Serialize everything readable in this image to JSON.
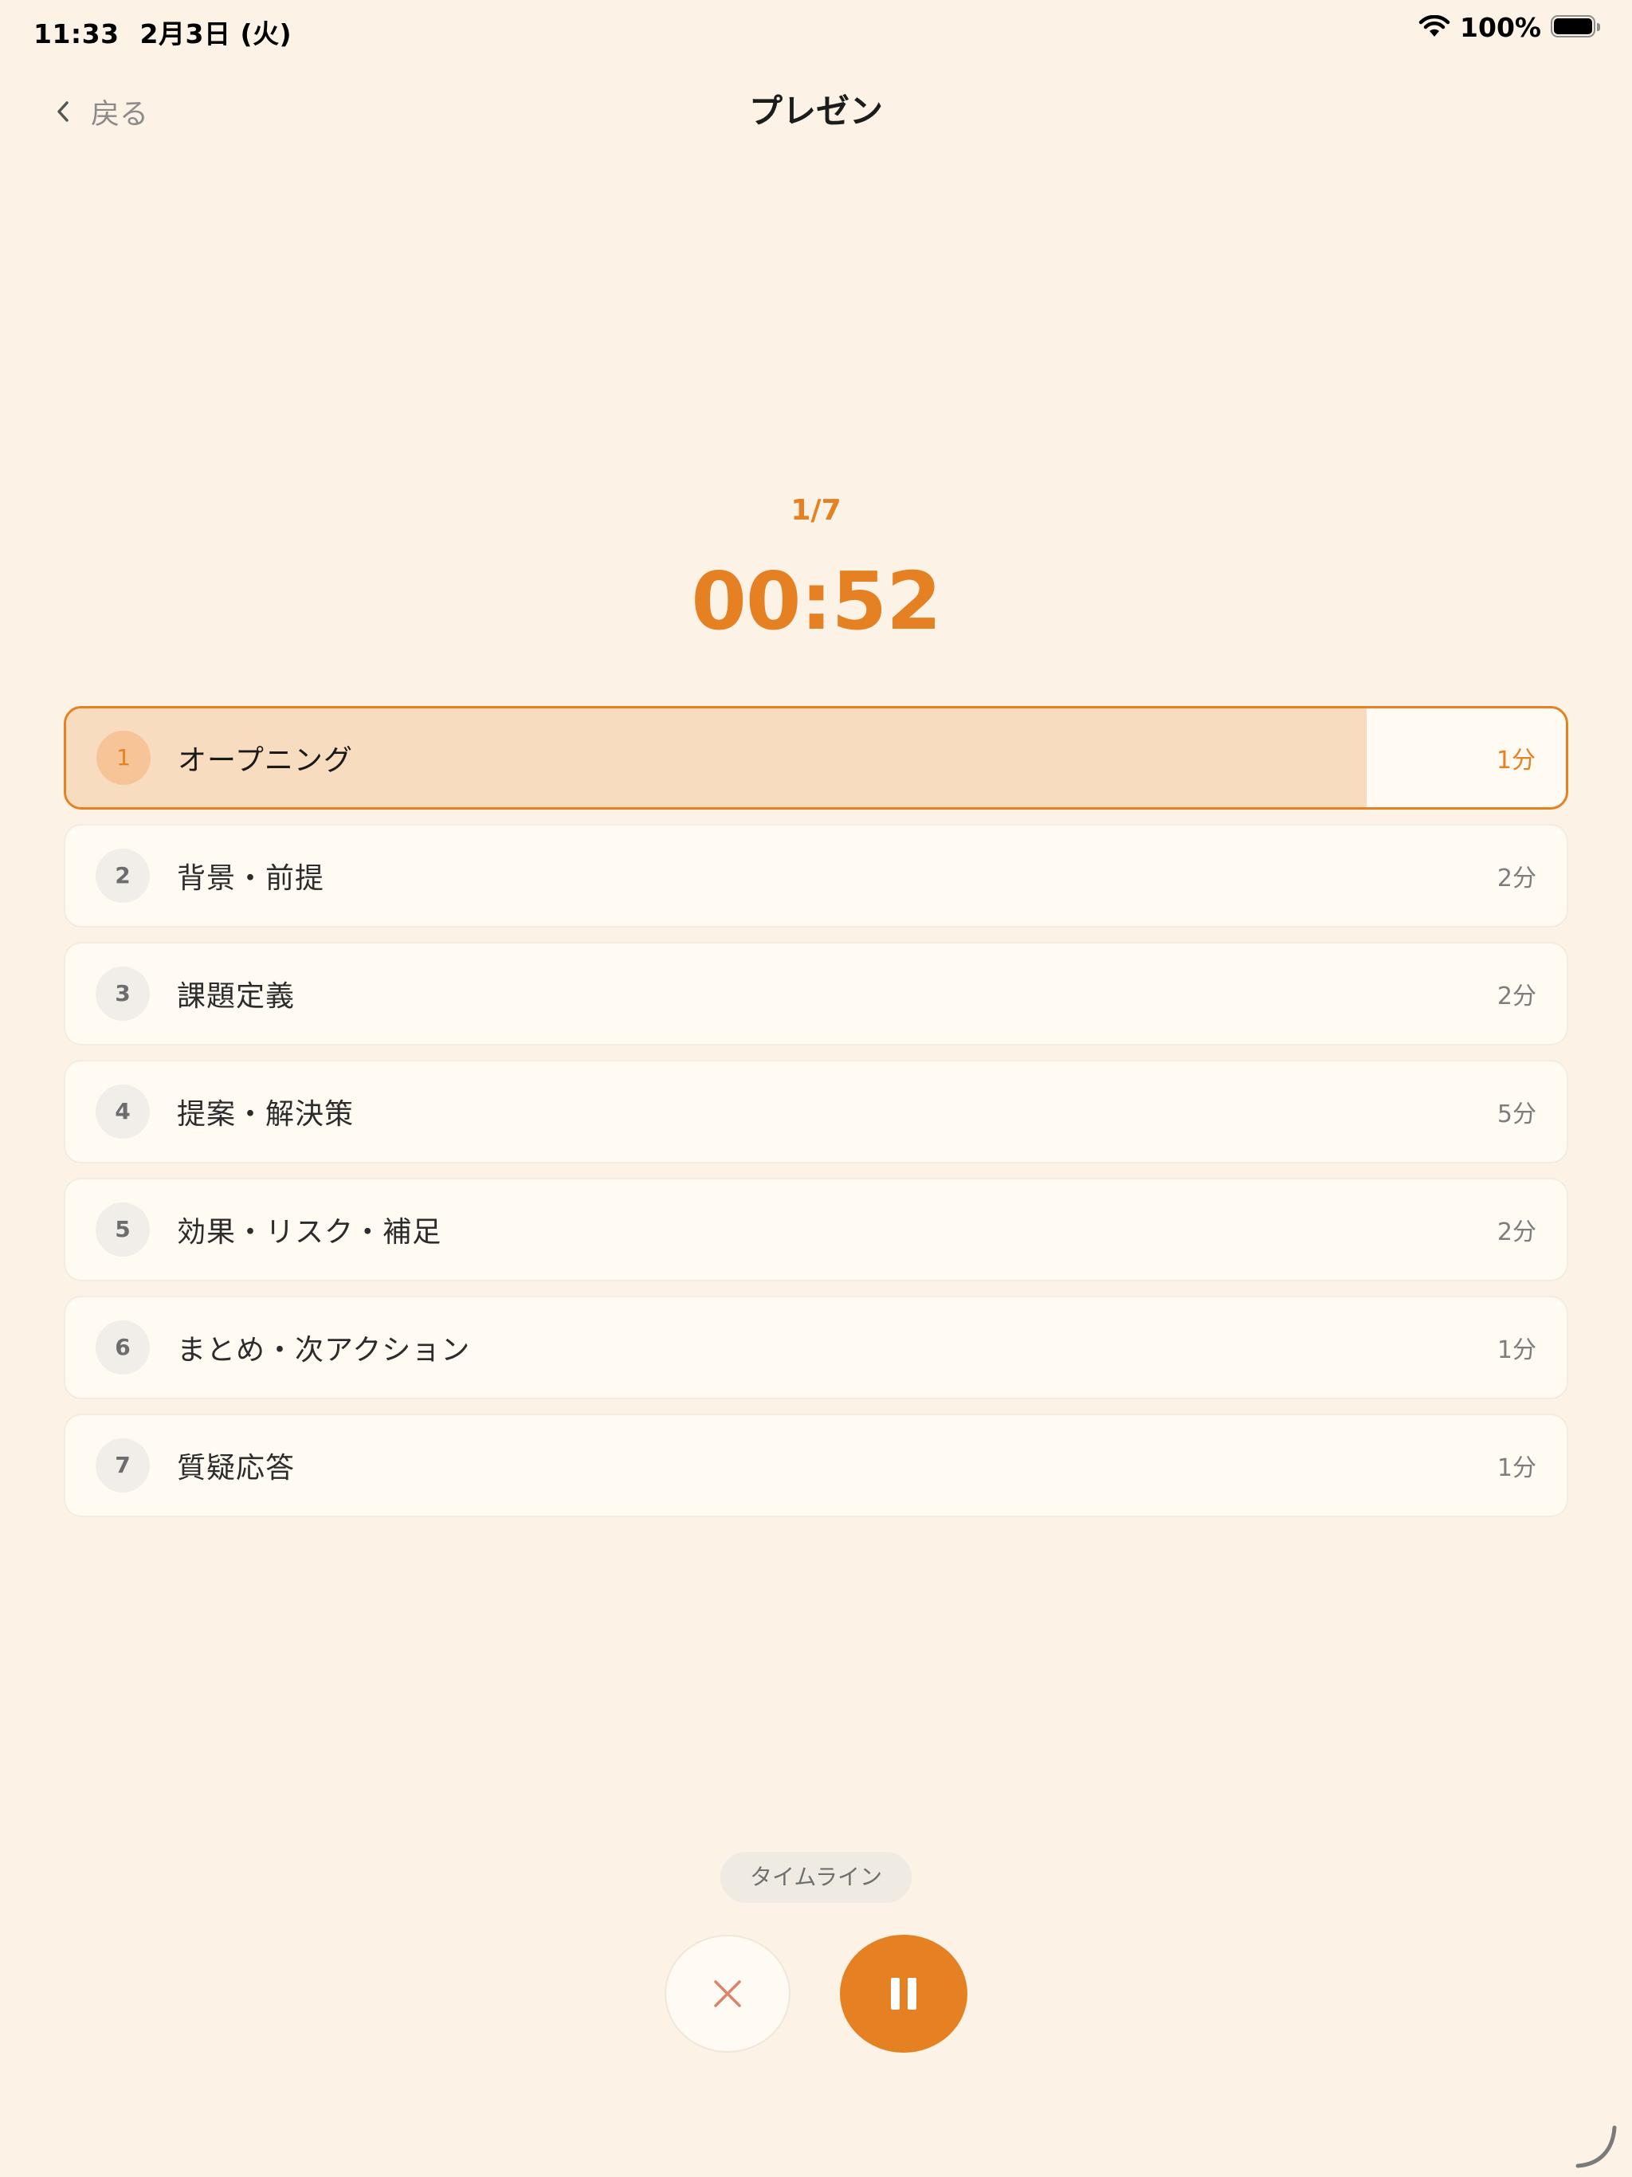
{
  "status_bar": {
    "time": "11:33",
    "date": "2月3日 (火)",
    "battery": "100%",
    "icons": [
      "wifi-icon",
      "battery-icon"
    ]
  },
  "nav": {
    "back_label": "戻る",
    "title": "プレゼン"
  },
  "timer": {
    "step_counter": "1/7",
    "time": "00:52",
    "active_progress_fraction": 0.867
  },
  "segments": [
    {
      "num": "1",
      "label": "オープニング",
      "duration": "1分",
      "active": true
    },
    {
      "num": "2",
      "label": "背景・前提",
      "duration": "2分",
      "active": false
    },
    {
      "num": "3",
      "label": "課題定義",
      "duration": "2分",
      "active": false
    },
    {
      "num": "4",
      "label": "提案・解決策",
      "duration": "5分",
      "active": false
    },
    {
      "num": "5",
      "label": "効果・リスク・補足",
      "duration": "2分",
      "active": false
    },
    {
      "num": "6",
      "label": "まとめ・次アクション",
      "duration": "1分",
      "active": false
    },
    {
      "num": "7",
      "label": "質疑応答",
      "duration": "1分",
      "active": false
    }
  ],
  "controls": {
    "timeline_label": "タイムライン",
    "stop_icon": "close-icon",
    "pause_icon": "pause-icon"
  },
  "colors": {
    "accent": "#e58122",
    "background": "#fcf2e6",
    "progress_fill": "#f8dcbf",
    "stop_icon_color": "#d9856a"
  }
}
